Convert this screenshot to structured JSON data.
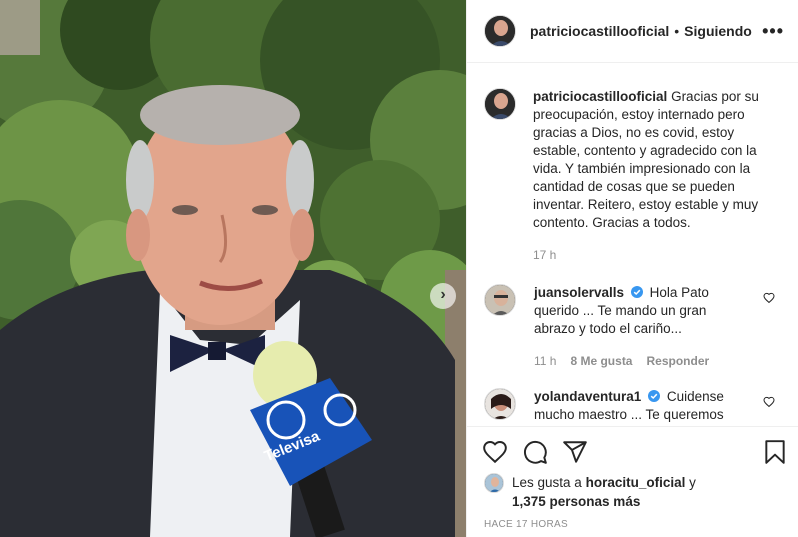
{
  "post": {
    "author": "patriciocastillooficial",
    "separator": "•",
    "follow_status": "Siguiendo",
    "more_label": "•••",
    "caption": "Gracias por su preocupación, estoy internado pero gracias a Dios, no es covid, estoy estable, contento y agradecido con la vida. Y también impresionado con la cantidad de cosas que se pueden inventar. Reitero, estoy estable y muy contento. Gracias a todos.",
    "caption_time": "17 h",
    "photo": {
      "microphone_brand": "Televisa"
    },
    "next_label": "›"
  },
  "comments": [
    {
      "author": "juansolervalls",
      "verified": true,
      "text": "Hola Pato querido ... Te mando un gran abrazo y todo el cariño...",
      "time": "11 h",
      "likes": "8 Me gusta",
      "reply": "Responder"
    },
    {
      "author": "yolandaventura1",
      "verified": true,
      "text": "Cuidense mucho maestro ... Te queremos",
      "time": "",
      "likes": "",
      "reply": ""
    }
  ],
  "likes": {
    "prefix": "Les gusta a",
    "user": "horacitu_oficial",
    "joiner": "y",
    "others": "1,375 personas más"
  },
  "time_ago": "HACE 17 HORAS",
  "icons": [
    "heart-icon",
    "comment-icon",
    "share-icon",
    "bookmark-icon",
    "more-icon",
    "verified-icon",
    "chevron-right-icon"
  ],
  "colors": {
    "verified": "#3897f0",
    "muted": "#8e8e8e",
    "text": "#262626",
    "border": "#efefef"
  }
}
